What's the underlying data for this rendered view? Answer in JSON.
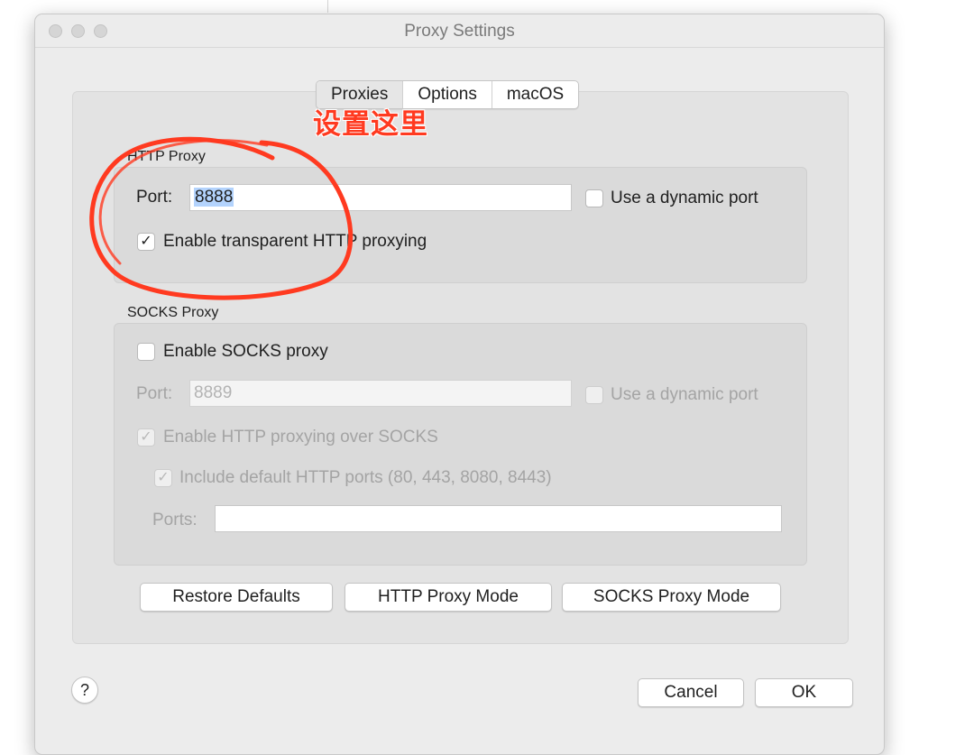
{
  "window": {
    "title": "Proxy Settings"
  },
  "tabs": [
    {
      "label": "Proxies",
      "active": true
    },
    {
      "label": "Options",
      "active": false
    },
    {
      "label": "macOS",
      "active": false
    }
  ],
  "annotation": {
    "text": "设置这里",
    "color": "#ff3a20"
  },
  "http_proxy": {
    "group_label": "HTTP Proxy",
    "port_label": "Port:",
    "port_value": "8888",
    "dynamic_port_label": "Use a dynamic port",
    "dynamic_port_checked": false,
    "transparent_label": "Enable transparent HTTP proxying",
    "transparent_checked": true
  },
  "socks_proxy": {
    "group_label": "SOCKS Proxy",
    "enable_label": "Enable SOCKS proxy",
    "enable_checked": false,
    "port_label": "Port:",
    "port_value": "8889",
    "dynamic_port_label": "Use a dynamic port",
    "http_over_socks_label": "Enable HTTP proxying over SOCKS",
    "http_over_socks_checked": true,
    "include_ports_label": "Include default HTTP ports (80, 443, 8080, 8443)",
    "include_ports_checked": true,
    "ports_label": "Ports:",
    "ports_value": ""
  },
  "buttons": {
    "restore_defaults": "Restore Defaults",
    "http_proxy_mode": "HTTP Proxy Mode",
    "socks_proxy_mode": "SOCKS Proxy Mode",
    "cancel": "Cancel",
    "ok": "OK",
    "help": "?"
  },
  "icons": {
    "checkmark": "✓"
  }
}
